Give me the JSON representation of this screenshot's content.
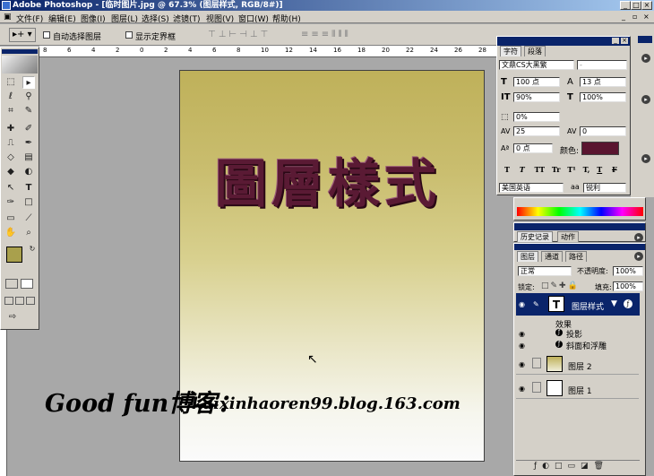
{
  "window": {
    "title": "Adobe Photoshop - [临时图片.jpg @ 67.3% (图层样式, RGB/8#)]",
    "buttons": [
      "_",
      "□",
      "×"
    ]
  },
  "menu": [
    "文件(F)",
    "编辑(E)",
    "图像(I)",
    "图层(L)",
    "选择(S)",
    "滤镜(T)",
    "视图(V)",
    "窗口(W)",
    "帮助(H)"
  ],
  "options_bar": {
    "auto_select": "自动选择图层",
    "show_bounds": "显示定界框"
  },
  "ruler": {
    "h_ticks": [
      "8",
      "6",
      "4",
      "2",
      "0",
      "2",
      "4",
      "6",
      "8",
      "10",
      "12",
      "14",
      "16",
      "18",
      "20",
      "22",
      "24",
      "26",
      "28"
    ]
  },
  "document": {
    "text": "圖層樣式"
  },
  "caption": {
    "prefix": "Good fun博客：",
    "url": "kaixinhaoren99.blog.163.com"
  },
  "char_panel": {
    "tab1": "字符",
    "tab2": "段落",
    "font": "文鼎CS大黑繁",
    "style": "-",
    "size": "100 点",
    "leading": "13 点",
    "vscale": "90%",
    "hscale": "100%",
    "baseline_shift": "0%",
    "tracking": "25",
    "kerning": "0",
    "shift": "0 点",
    "color_label": "颜色:",
    "color": "#5a1530",
    "styles": [
      "T",
      "T",
      "TT",
      "Tr",
      "T¹",
      "T,",
      "T",
      "F"
    ],
    "language": "美国英语",
    "aa_icon": "aa",
    "antialias": "锐利"
  },
  "history_panel": {
    "tab1": "历史记录",
    "tab2": "动作"
  },
  "layers_panel": {
    "tabs": [
      "图层",
      "通道",
      "路径"
    ],
    "blend_mode": "正常",
    "opacity_label": "不透明度:",
    "opacity": "100%",
    "lock_label": "锁定:",
    "fill_label": "填充:",
    "fill": "100%",
    "type_thumb": "T",
    "layers": [
      {
        "name": "图层样式",
        "type": "text",
        "selected": true
      },
      {
        "name": "图层 2",
        "type": "image",
        "selected": false
      },
      {
        "name": "图层 1",
        "type": "image",
        "selected": false
      }
    ],
    "effects_label": "效果",
    "effects": [
      "投影",
      "斜面和浮雕"
    ]
  }
}
